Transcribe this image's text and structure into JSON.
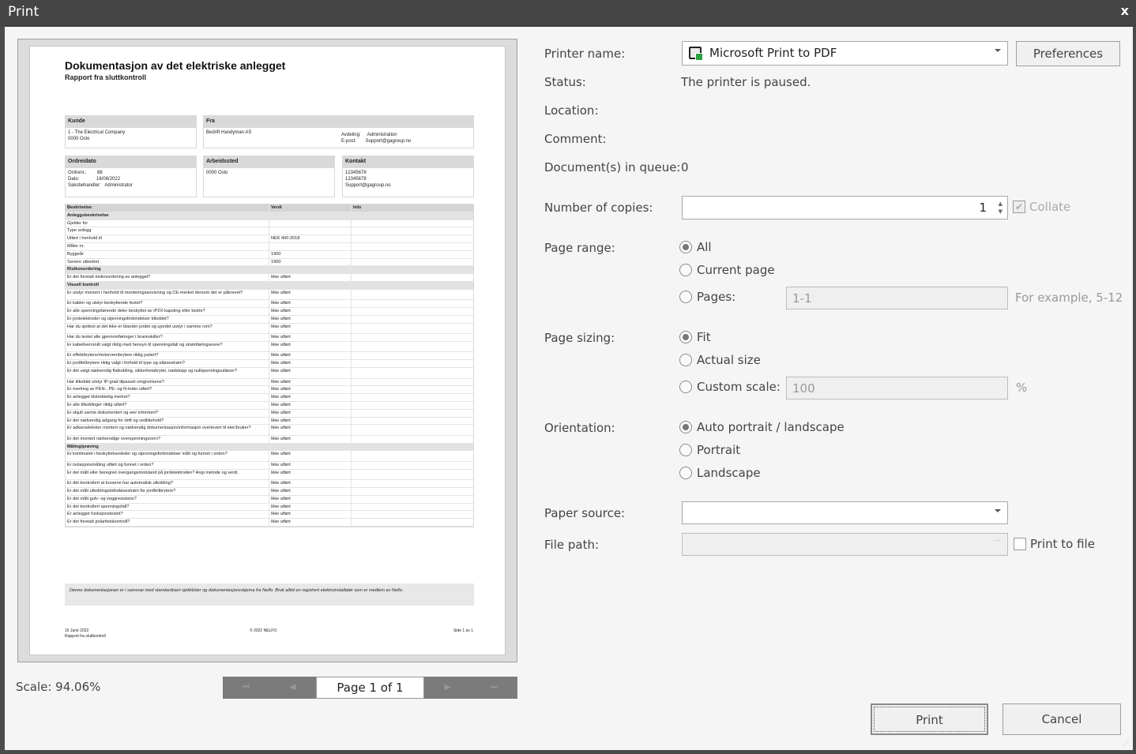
{
  "window": {
    "title": "Print",
    "close": "x"
  },
  "preview": {
    "doc_title": "Dokumentasjon av det elektriske anlegget",
    "doc_subtitle": "Rapport fra sluttkontroll",
    "kunde_h": "Kunde",
    "kunde_v": "1 - The Electrical Company\n0000 Oslo",
    "fra_h": "Fra",
    "fra_v": "Bedrift Handyman AS",
    "fra_right": "Avdeling:     Administration\nE-post:       Support@gagroup.no",
    "ordre_h": "Ordreidato",
    "ordre_v": "Ordrenr.:        88\nDato:             16/06/2022\nSaksbehandler:   Administrator",
    "arb_h": "Arbeidssted",
    "arb_v": "0000 Oslo",
    "kontakt_h": "Kontakt",
    "kontakt_v": "12345678\n12345678\nSupport@gagroup.no",
    "table_header": [
      "Beskrivelse",
      "Verdi",
      "Info"
    ],
    "rows": [
      {
        "t": "sec",
        "d": "Anleggsbeskrivelse",
        "v": ""
      },
      {
        "d": "Gjelder for",
        "v": ""
      },
      {
        "d": "Type anlegg",
        "v": ""
      },
      {
        "d": "Utført i henhold til",
        "v": "NEK 400:2018"
      },
      {
        "d": "Måler nr.",
        "v": ""
      },
      {
        "d": "Byggeår",
        "v": "1900"
      },
      {
        "d": "Senere utbedret",
        "v": "1900"
      },
      {
        "t": "sec",
        "d": "Risikovurdering",
        "v": ""
      },
      {
        "d": "Er det foretatt risikovurdering av anlegget?",
        "v": "Ikke utført"
      },
      {
        "t": "sec",
        "d": "Visuell kontroll",
        "v": ""
      },
      {
        "d": "Er utstyr montert i henhold til monteringsanvisning og CE-merket dersom det er påkrevet?",
        "v": "Ikke utført"
      },
      {
        "d": "Er kabler og utstyr beskyttende festet?",
        "v": "Ikke utført"
      },
      {
        "d": "Er alle spenningsførende deler beskyttet av IP2X-kapsling eller bedre?",
        "v": "Ikke utført"
      },
      {
        "d": "Er jordelektroder og utjevningsforbindelser tilkoblet?",
        "v": "Ikke utført"
      },
      {
        "d": "Har du sjekket at det ikke er blander jordet og ujordet utstyr i samme rom?",
        "v": "Ikke utført"
      },
      {
        "d": "Har du testet alle gjennomføringer i brannskiller?",
        "v": "Ikke utført"
      },
      {
        "d": "Er kabeltverrsnitt valgt riktig med hensyn til spenningsfall og strømføringsevne?",
        "v": "Ikke utført"
      },
      {
        "d": "Er effektbrytere/motorvernbrytere riktig justert?",
        "v": "Ikke utført"
      },
      {
        "d": "Er jordfeilbrytere riktig valgt i forhold til type og utløsestrøm?",
        "v": "Ikke utført"
      },
      {
        "d": "Er det valgt nødvendig flatkobling, sikkerhetsbryter, nødstopp og nullspenningsutløser?",
        "v": "Ikke utført"
      },
      {
        "d": "Har tilkoblet utstyr IP-grad tilpasset omgivelsene?",
        "v": "Ikke utført"
      },
      {
        "d": "Er merking av PEN-, PE- og N-leder utført?",
        "v": "Ikke utført"
      },
      {
        "d": "Er anlegget tilstrekkelig merket?",
        "v": "Ikke utført"
      },
      {
        "d": "Er alle tilkoblinger riktig utført?",
        "v": "Ikke utført"
      },
      {
        "d": "Er skjult varme dokumentert og eier informert?",
        "v": "Ikke utført"
      },
      {
        "d": "Er det nødvendig adgang for drift og vedlikehold?",
        "v": "Ikke utført"
      },
      {
        "d": "Er adkarselekster montert og nødvendig dokumentasjon/informasjon overlevert til eier/bruker?",
        "v": "Ikke utført"
      },
      {
        "d": "Er det montert nødvendige overspenningsvern?",
        "v": "Ikke utført"
      },
      {
        "t": "sec",
        "d": "Måling/prøving",
        "v": ""
      },
      {
        "d": "Er kontinuitet i beskyttelsesleder og utjevningsforbindelser målt og funnet i orden?",
        "v": "Ikke utført"
      },
      {
        "d": "Er isolasjonsmåling utført og funnet i orden?",
        "v": "Ikke utført"
      },
      {
        "d": "Er det målt eller beregnet overgangsmotstand på jordelektroden? Angi metode og verdi.",
        "v": "Ikke utført"
      },
      {
        "d": "Er det kontrollert at kursene har automatisk utkobling?",
        "v": "Ikke utført"
      },
      {
        "d": "Er det målt utkoblingstid/utløsestrøm for jordfeilbrytere?",
        "v": "Ikke utført"
      },
      {
        "d": "Er det målt gulv- og veggresistans?",
        "v": "Ikke utført"
      },
      {
        "d": "Er det kontrollert spenningsfall?",
        "v": "Ikke utført"
      },
      {
        "d": "Er anlegget funksjonstestet?",
        "v": "Ikke utført"
      },
      {
        "d": "Er det foretatt polaritetskontroll?",
        "v": "Ikke utført"
      }
    ],
    "note": "Denne dokumentasjonen er i samsvar med standardisert sjekklister og dokumentasjonsskjema fra Nelfo. Bruk alltid en registrert elektroinstallatør som er medlem av Nelfo.",
    "footer_left": "16 June 2022\nRapport fra sluttkontroll",
    "footer_center": "© 2022 NELFO",
    "footer_right": "Side 1 av 1"
  },
  "scale": "Scale: 94.06%",
  "nav": {
    "first": "⏮",
    "prev": "◀",
    "page": "Page 1 of 1",
    "next": "▶",
    "last": "⏭"
  },
  "labels": {
    "printer": "Printer name:",
    "status": "Status:",
    "location": "Location:",
    "comment": "Comment:",
    "queue": "Document(s) in queue:",
    "copies": "Number of copies:",
    "range": "Page range:",
    "sizing": "Page sizing:",
    "orientation": "Orientation:",
    "source": "Paper source:",
    "filepath": "File path:"
  },
  "values": {
    "printer": "Microsoft Print to PDF",
    "status": "The printer is paused.",
    "queue": "0",
    "copies": "1",
    "pages_value": "1-1",
    "pages_hint": "For example, 5-12",
    "scale_value": "100",
    "percent": "%",
    "filepath_ellipsis": "···"
  },
  "buttons": {
    "preferences": "Preferences",
    "print": "Print",
    "cancel": "Cancel"
  },
  "checks": {
    "collate": "Collate",
    "print_to_file": "Print to file"
  },
  "radios": {
    "all": "All",
    "current": "Current page",
    "pages": "Pages:",
    "fit": "Fit",
    "actual": "Actual size",
    "custom": "Custom scale:",
    "auto": "Auto portrait / landscape",
    "portrait": "Portrait",
    "landscape": "Landscape"
  }
}
